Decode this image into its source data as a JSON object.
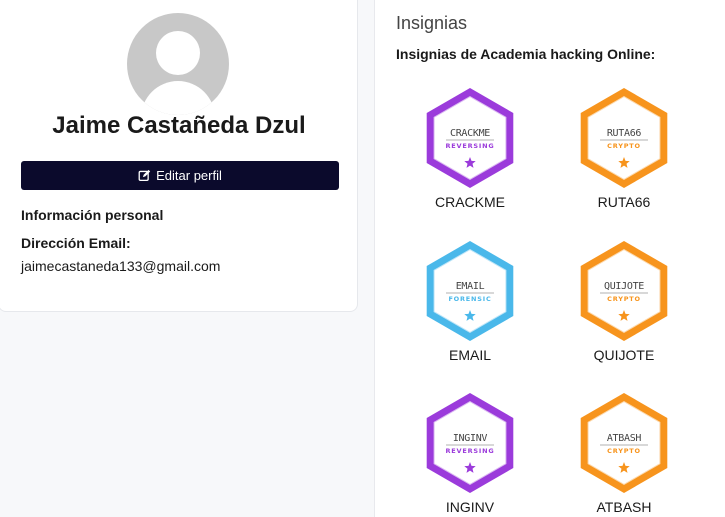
{
  "profile": {
    "name": "Jaime Castañeda Dzul",
    "edit_label": "Editar perfil",
    "personal_info_label": "Información personal",
    "email_label": "Dirección Email:",
    "email_value": "jaimecastaneda133@gmail.com"
  },
  "badges_panel": {
    "title": "Insignias",
    "subtitle": "Insignias de Academia hacking Online:",
    "badges": [
      {
        "label": "CRACKME",
        "art_title": "CRACKME",
        "art_sub": "REVERSING",
        "color": "#9b3bdb"
      },
      {
        "label": "RUTA66",
        "art_title": "RUTA66",
        "art_sub": "CRYPTO",
        "color": "#f7941d"
      },
      {
        "label": "EMAIL",
        "art_title": "EMAIL",
        "art_sub": "FORENSIC",
        "color": "#4ab8ea"
      },
      {
        "label": "QUIJOTE",
        "art_title": "QUIJOTE",
        "art_sub": "CRYPTO",
        "color": "#f7941d"
      },
      {
        "label": "INGINV",
        "art_title": "INGINV",
        "art_sub": "REVERSING",
        "color": "#9b3bdb"
      },
      {
        "label": "ATBASH",
        "art_title": "ATBASH",
        "art_sub": "CRYPTO",
        "color": "#f7941d"
      }
    ]
  }
}
